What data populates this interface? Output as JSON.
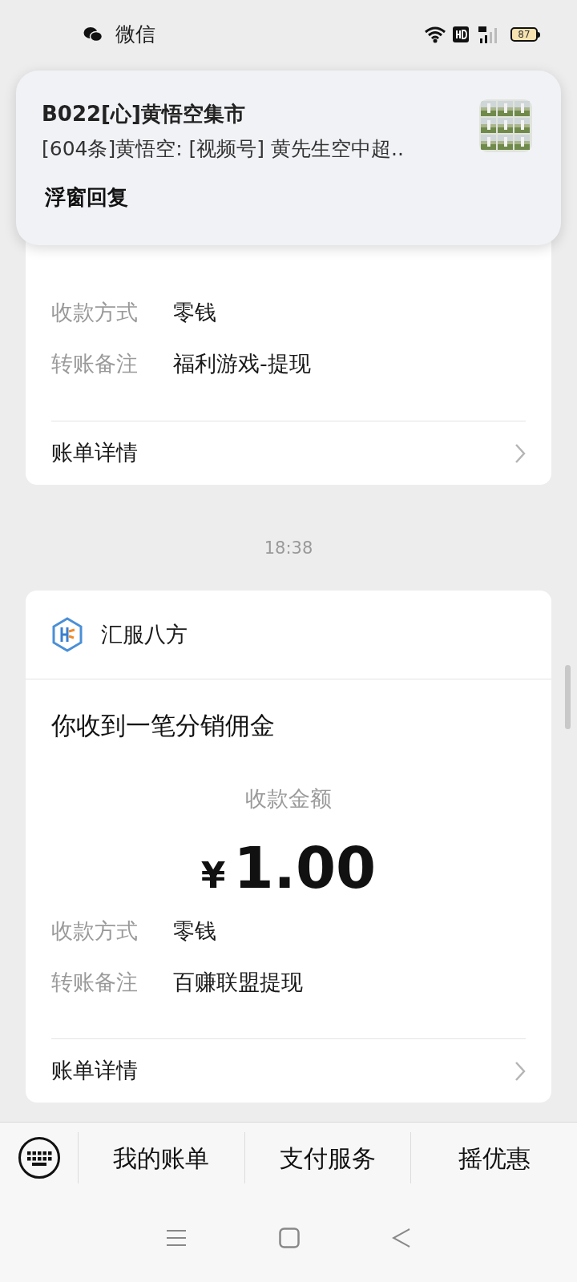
{
  "status_bar": {
    "app": "微信",
    "battery": "87"
  },
  "notification": {
    "title": "B022[心]黄悟空集市",
    "message": "[604条]黄悟空: [视频号] 黄先生空中超..",
    "action": "浮窗回复"
  },
  "cards": [
    {
      "rows": [
        {
          "label": "收款方式",
          "value": "零钱"
        },
        {
          "label": "转账备注",
          "value": "福利游戏-提现"
        }
      ],
      "detail": "账单详情"
    },
    {
      "time": "18:38",
      "merchant": "汇服八方",
      "title": "你收到一笔分销佣金",
      "amount_label": "收款金额",
      "amount": {
        "currency": "¥",
        "value": "1.00"
      },
      "rows": [
        {
          "label": "收款方式",
          "value": "零钱"
        },
        {
          "label": "转账备注",
          "value": "百赚联盟提现"
        }
      ],
      "detail": "账单详情"
    }
  ],
  "menu": [
    "我的账单",
    "支付服务",
    "摇优惠"
  ]
}
